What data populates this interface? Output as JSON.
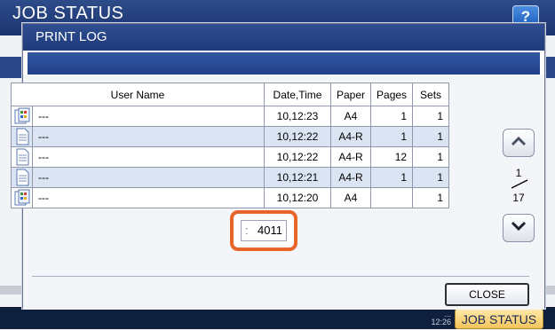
{
  "app": {
    "title": "JOB STATUS",
    "help_label": "?"
  },
  "footer": {
    "time_line1": "...",
    "time_line2": "12:26",
    "tab_label": "JOB STATUS"
  },
  "dialog": {
    "title": "PRINT LOG",
    "close_label": "CLOSE"
  },
  "table": {
    "headers": {
      "user": "User Name",
      "date": "Date,Time",
      "paper": "Paper",
      "pages": "Pages",
      "sets": "Sets"
    },
    "rows": [
      {
        "icon": "color-copy-icon",
        "user": "---",
        "date": "10,12:23",
        "paper": "A4",
        "pages": "1",
        "sets": "1"
      },
      {
        "icon": "document-icon",
        "user": "---",
        "date": "10,12:22",
        "paper": "A4-R",
        "pages": "1",
        "sets": "1"
      },
      {
        "icon": "document-icon",
        "user": "---",
        "date": "10,12:22",
        "paper": "A4-R",
        "pages": "12",
        "sets": "1"
      },
      {
        "icon": "document-icon",
        "user": "---",
        "date": "10,12:21",
        "paper": "A4-R",
        "pages": "1",
        "sets": "1"
      },
      {
        "icon": "color-copy-icon",
        "user": "---",
        "date": "10,12:20",
        "paper": "A4",
        "pages": "",
        "sets": "1"
      }
    ]
  },
  "pagination": {
    "current": "1",
    "total": "17"
  },
  "callout": {
    "colon": ":",
    "value": "4011"
  },
  "colors": {
    "accent_orange": "#e8652a",
    "title_blue": "#1f3a7a",
    "row_alt": "#dbe4f2"
  }
}
